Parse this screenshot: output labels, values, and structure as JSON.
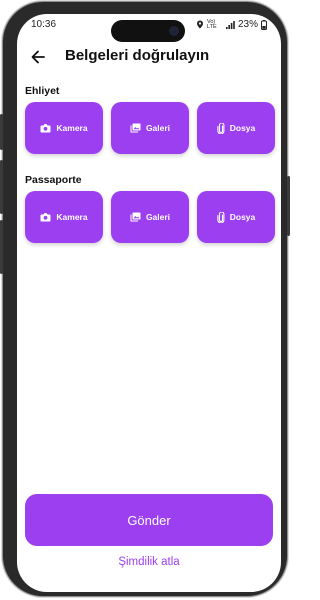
{
  "status_bar": {
    "time": "10:36",
    "network": "Vo) LTE",
    "battery": "23%"
  },
  "header": {
    "title": "Belgeleri doğrulayın"
  },
  "sections": [
    {
      "label": "Ehliyet",
      "buttons": [
        {
          "label": "Kamera",
          "icon": "camera-icon"
        },
        {
          "label": "Galeri",
          "icon": "gallery-icon"
        },
        {
          "label": "Dosya",
          "icon": "paperclip-icon"
        }
      ]
    },
    {
      "label": "Passaporte",
      "buttons": [
        {
          "label": "Kamera",
          "icon": "camera-icon"
        },
        {
          "label": "Galeri",
          "icon": "gallery-icon"
        },
        {
          "label": "Dosya",
          "icon": "paperclip-icon"
        }
      ]
    }
  ],
  "actions": {
    "submit_label": "Gönder",
    "skip_label": "Şimdilik atla"
  },
  "colors": {
    "accent": "#9b3ff0",
    "frame": "#2a2a2a"
  }
}
